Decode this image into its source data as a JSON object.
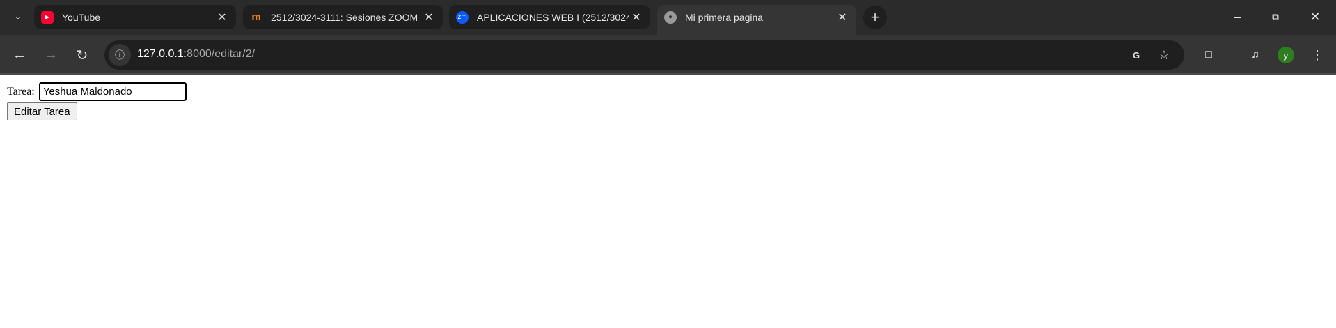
{
  "browser": {
    "tabs": [
      {
        "title": "YouTube",
        "favicon": "youtube-icon",
        "color": "#ff0033"
      },
      {
        "title": "2512/3024-3111: Sesiones ZOOM",
        "favicon": "moodle-icon",
        "color": "#f98012"
      },
      {
        "title": "APLICACIONES WEB I (2512/3024",
        "favicon": "zoom-icon",
        "color": "#0b5cff",
        "favicon_text": "zm"
      },
      {
        "title": "Mi primera pagina",
        "favicon": "globe-icon",
        "active": true
      }
    ],
    "url_host": "127.0.0.1",
    "url_rest": ":8000/editar/2/",
    "avatar_letter": "y",
    "avatar_color": "#2e7d1f"
  },
  "form": {
    "label": "Tarea:",
    "value": "Yeshua Maldonado",
    "submit_label": "Editar Tarea"
  }
}
